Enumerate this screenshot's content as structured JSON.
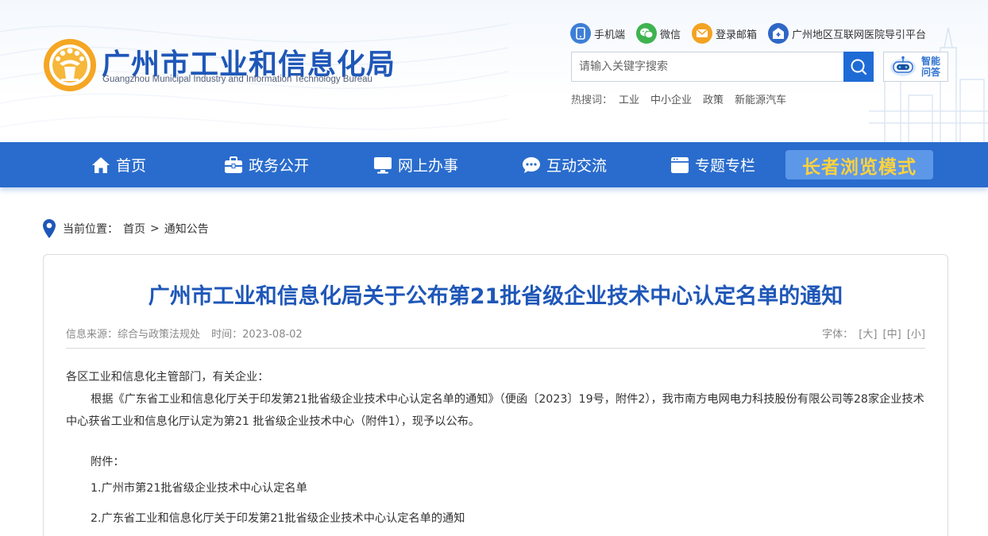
{
  "header": {
    "brand_cn": "广州市工业和信息化局",
    "brand_en": "Guangzhou Municipal Industry and Information Technology Bureau",
    "quick_links": [
      {
        "label": "手机端",
        "icon": "mobile-icon",
        "color": "#3d7fd6"
      },
      {
        "label": "微信",
        "icon": "wechat-icon",
        "color": "#3fb34f"
      },
      {
        "label": "登录邮箱",
        "icon": "mail-icon",
        "color": "#f3a322"
      },
      {
        "label": "广州地区互联网医院导引平台",
        "icon": "hospital-icon",
        "color": "#2f67c6"
      }
    ],
    "search": {
      "placeholder": "请输入关键字搜索"
    },
    "smart_qa": {
      "line1": "智能",
      "line2": "问答"
    },
    "hot": {
      "label": "热搜词：",
      "words": [
        "工业",
        "中小企业",
        "政策",
        "新能源汽车"
      ]
    }
  },
  "nav": {
    "items": [
      {
        "label": "首页",
        "icon": "home-icon"
      },
      {
        "label": "政务公开",
        "icon": "briefcase-icon"
      },
      {
        "label": "网上办事",
        "icon": "monitor-icon"
      },
      {
        "label": "互动交流",
        "icon": "chat-icon"
      },
      {
        "label": "专题专栏",
        "icon": "folder-icon"
      }
    ],
    "elder_mode": "长者浏览模式",
    "color": "#2a6ccd"
  },
  "breadcrumb": {
    "label": "当前位置：",
    "home": "首页",
    "sep": ">",
    "current": "通知公告"
  },
  "article": {
    "title": "广州市工业和信息化局关于公布第21批省级企业技术中心认定名单的通知",
    "source": "信息来源：综合与政策法规处",
    "time": "时间：2023-08-02",
    "font_label": "字体：",
    "font_large": "[大]",
    "font_medium": "[中]",
    "font_small": "[小]",
    "salutation": "各区工业和信息化主管部门，有关企业：",
    "paragraph": "根据《广东省工业和信息化厅关于印发第21批省级企业技术中心认定名单的通知》（便函〔2023〕19号，附件2），我市南方电网电力科技股份有限公司等28家企业技术中心获省工业和信息化厅认定为第21 批省级企业技术中心（附件1），现予以公布。",
    "attachments_label": "附件：",
    "attachments": [
      "1.广州市第21批省级企业技术中心认定名单",
      "2.广东省工业和信息化厅关于印发第21批省级企业技术中心认定名单的通知"
    ]
  }
}
